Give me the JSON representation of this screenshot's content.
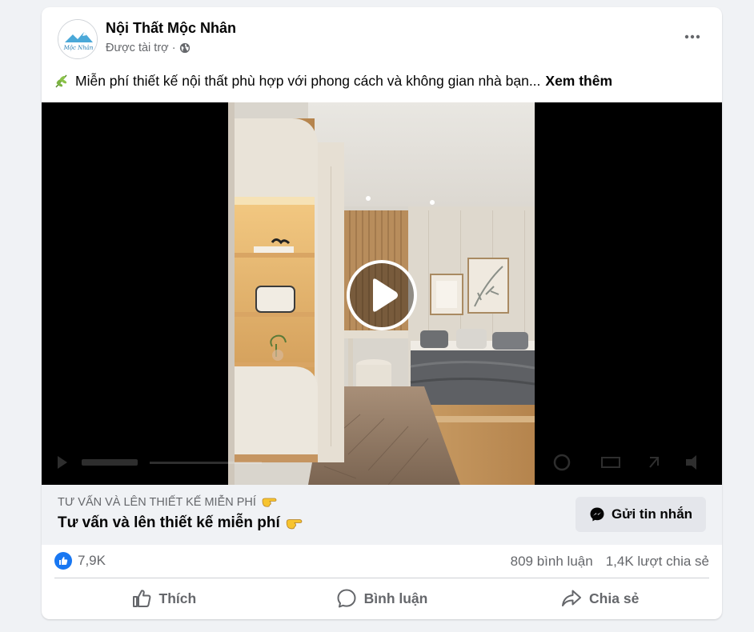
{
  "post": {
    "page_name": "Nội Thất Mộc Nhân",
    "sponsored_label": "Được tài trợ",
    "separator": "·",
    "text": "Miễn phí thiết kế nội thất phù hợp với phong cách và không gian nhà bạn...",
    "see_more": "Xem thêm",
    "avatar_logo_text": "Mộc Nhân"
  },
  "cta": {
    "caption": "TƯ VẤN VÀ LÊN THIẾT KẾ MIỄN PHÍ",
    "title": "Tư vấn và lên thiết kế miễn phí",
    "button_label": "Gửi tin nhắn"
  },
  "stats": {
    "likes": "7,9K",
    "comments": "809 bình luận",
    "shares": "1,4K lượt chia sẻ"
  },
  "actions": {
    "like": "Thích",
    "comment": "Bình luận",
    "share": "Chia sẻ"
  },
  "icons": {
    "globe": "globe-icon",
    "more": "more-options-icon",
    "leaf": "herb-emoji-icon",
    "point": "backhand-index-pointing-right-icon",
    "messenger": "messenger-icon",
    "like_badge": "like-reaction-icon",
    "play": "play-icon"
  },
  "colors": {
    "brand_blue": "#1877f2",
    "secondary_text": "#65676b",
    "cta_background": "#f0f2f5",
    "button_background": "#e4e6eb"
  }
}
